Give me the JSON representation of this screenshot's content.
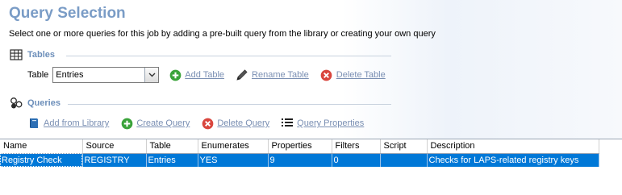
{
  "header": {
    "title": "Query Selection",
    "subtitle": "Select one or more queries for this job by adding a pre-built query from the library or creating your own query"
  },
  "tables_section": {
    "heading": "Tables",
    "table_label": "Table",
    "selected_table": "Entries",
    "actions": {
      "add": "Add Table",
      "rename": "Rename Table",
      "delete": "Delete Table"
    }
  },
  "queries_section": {
    "heading": "Queries",
    "actions": {
      "add_from_library": "Add from Library",
      "create": "Create Query",
      "delete": "Delete Query",
      "properties": "Query Properties"
    }
  },
  "grid": {
    "columns": [
      "Name",
      "Source",
      "Table",
      "Enumerates",
      "Properties",
      "Filters",
      "Script",
      "Description"
    ],
    "rows": [
      {
        "name": "Registry Check",
        "source": "REGISTRY",
        "table": "Entries",
        "enumerates": "YES",
        "properties": "9",
        "filters": "0",
        "script": "",
        "description": "Checks for LAPS-related registry keys",
        "selected": true
      }
    ]
  },
  "colors": {
    "title": "#7a9cc6",
    "section_heading": "#6d8fba",
    "link": "#7a8fb3",
    "selection": "#0078d7",
    "add_green": "#3aa33a",
    "delete_red": "#d9463e"
  },
  "icons": {
    "tables": "table-grid-icon",
    "queries": "queries-cubes-icon",
    "add": "plus-circle-icon",
    "rename": "pencil-icon",
    "delete": "x-circle-icon",
    "library": "book-icon",
    "properties": "list-icon"
  }
}
